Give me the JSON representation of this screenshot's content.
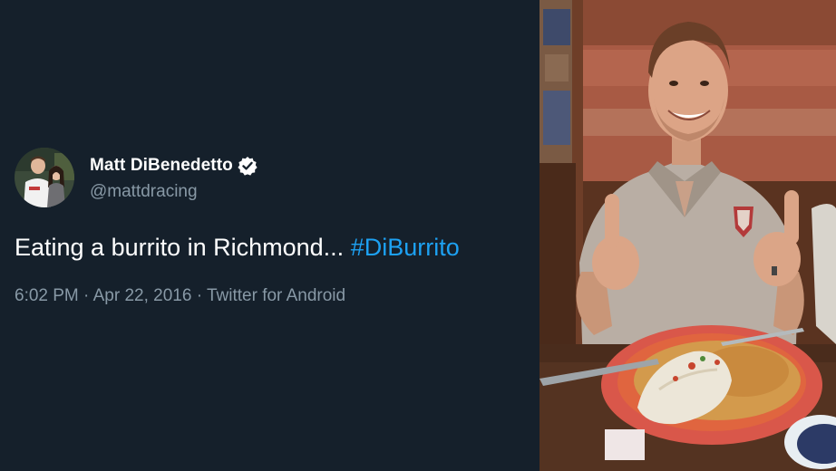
{
  "tweet": {
    "author_name": "Matt DiBenedetto",
    "handle": "@mattdracing",
    "verified_icon": "verified-badge-icon",
    "text": "Eating a burrito in Richmond... ",
    "hashtag": "#DiBurrito",
    "time": "6:02 PM",
    "separator": " · ",
    "date": "Apr 22, 2016",
    "source": "Twitter for Android"
  },
  "colors": {
    "background": "#15202b",
    "text": "#ffffff",
    "secondary_text": "#8899a6",
    "accent": "#1da1f2"
  }
}
